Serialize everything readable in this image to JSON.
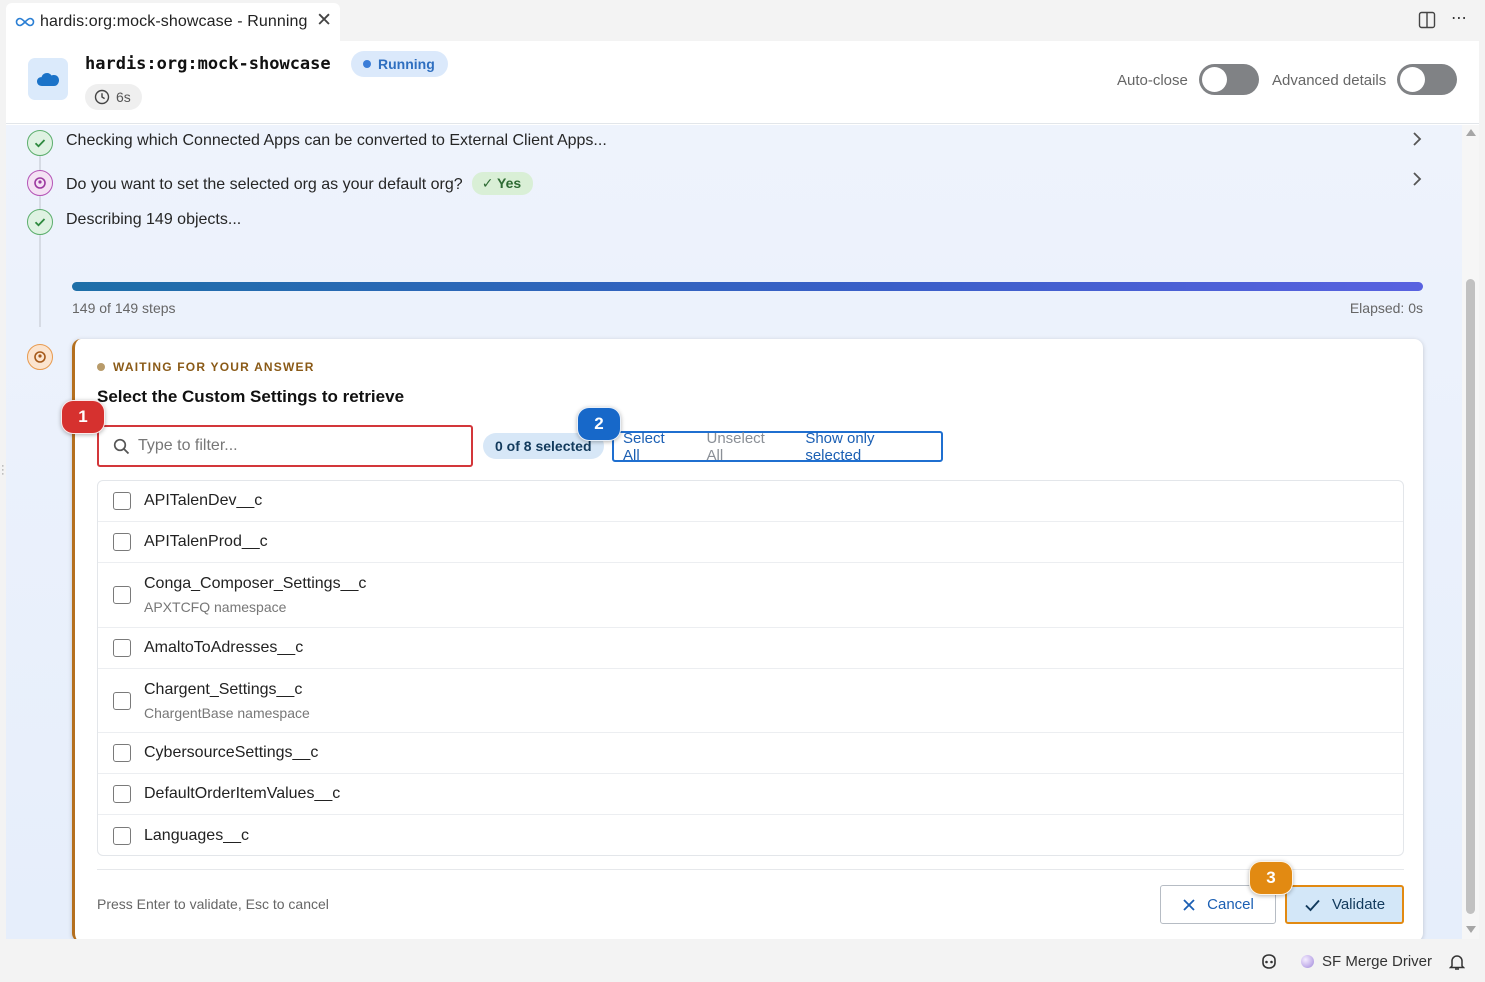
{
  "tab": {
    "title": "hardis:org:mock-showcase - Running"
  },
  "header": {
    "command": "hardis:org:mock-showcase",
    "status": "Running",
    "elapsed": "6s",
    "auto_close_label": "Auto-close",
    "advanced_details_label": "Advanced details",
    "auto_close_on": false,
    "advanced_details_on": false
  },
  "steps": [
    {
      "text": "Checking which Connected Apps can be converted to External Client Apps...",
      "state": "done"
    },
    {
      "text": "Do you want to set the selected org as your default org?",
      "state": "answered",
      "answer": "✓ Yes"
    },
    {
      "text": "Describing 149 objects...",
      "state": "done"
    }
  ],
  "progress": {
    "fraction": 1.0,
    "label": "149 of 149 steps",
    "elapsed": "Elapsed: 0s"
  },
  "prompt": {
    "waiting_label": "WAITING FOR YOUR ANSWER",
    "question": "Select the Custom Settings to retrieve",
    "filter_placeholder": "Type to filter...",
    "selected_count": "0 of 8 selected",
    "select_all": "Select All",
    "unselect_all": "Unselect All",
    "show_only_selected": "Show only selected",
    "items": [
      {
        "name": "APITalenDev__c",
        "sub": ""
      },
      {
        "name": "APITalenProd__c",
        "sub": ""
      },
      {
        "name": "Conga_Composer_Settings__c",
        "sub": "APXTCFQ namespace"
      },
      {
        "name": "AmaltoToAdresses__c",
        "sub": ""
      },
      {
        "name": "Chargent_Settings__c",
        "sub": "ChargentBase namespace"
      },
      {
        "name": "CybersourceSettings__c",
        "sub": ""
      },
      {
        "name": "DefaultOrderItemValues__c",
        "sub": ""
      },
      {
        "name": "Languages__c",
        "sub": ""
      }
    ],
    "hint": "Press Enter to validate, Esc to cancel",
    "cancel_label": "Cancel",
    "validate_label": "Validate"
  },
  "markers": {
    "m1": "1",
    "m2": "2",
    "m3": "3"
  },
  "statusbar": {
    "merge_driver": "SF Merge Driver"
  },
  "colors": {
    "accent": "#1b5fb3",
    "progress": "#3a5fc8",
    "marker_red": "#d6312f",
    "marker_blue": "#1768c9",
    "marker_orange": "#e28a12"
  }
}
